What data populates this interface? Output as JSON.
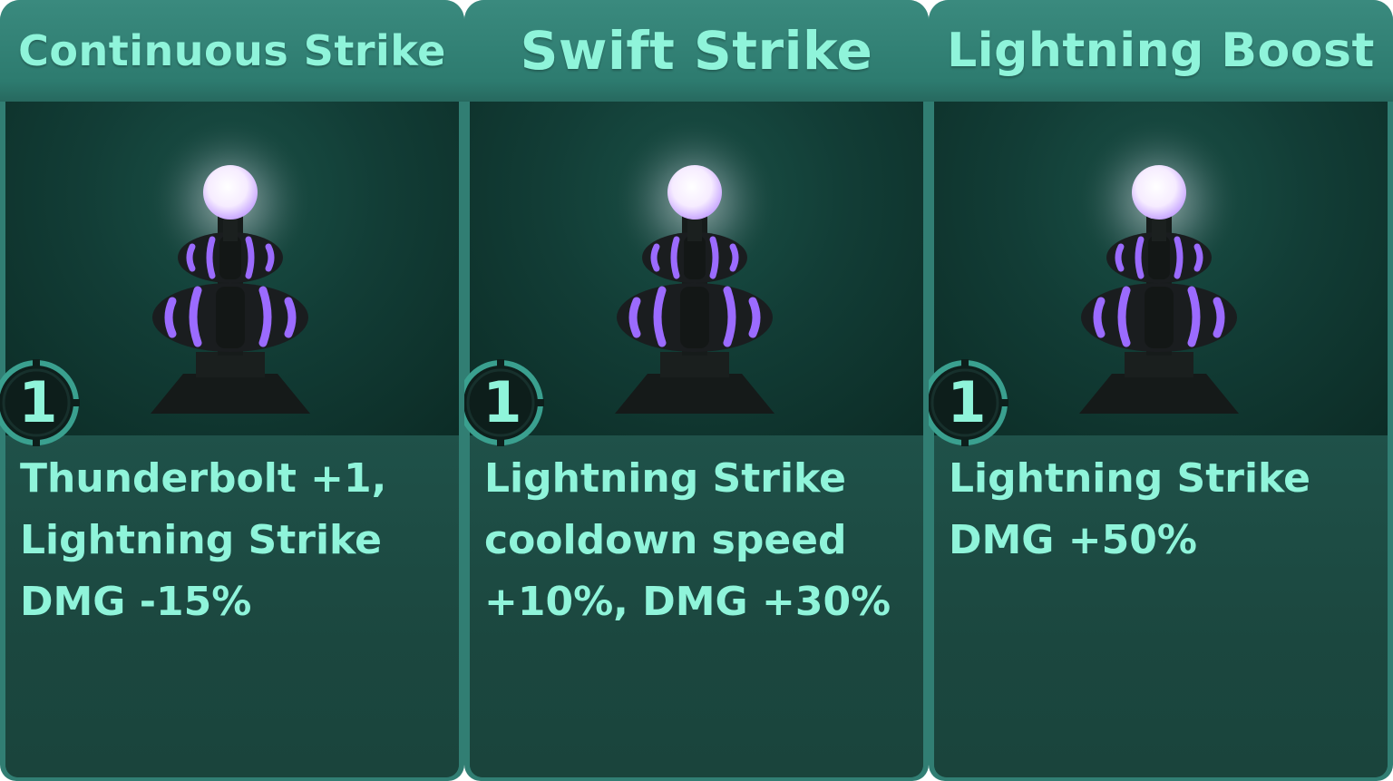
{
  "cards": [
    {
      "title": "Continuous Strike",
      "level": "1",
      "description": "Thunderbolt +1,\nLightning Strike\nDMG -15%",
      "icon": "lightning-tower-icon"
    },
    {
      "title": "Swift Strike",
      "level": "1",
      "description": "Lightning Strike\ncooldown speed\n+10%, DMG +30%",
      "icon": "lightning-tower-icon"
    },
    {
      "title": "Lightning Boost",
      "level": "1",
      "description": "Lightning Strike\nDMG +50%",
      "icon": "lightning-tower-icon"
    }
  ],
  "colors": {
    "card_frame": "#317e73",
    "card_body": "#1c4a42",
    "text": "#8ff4da",
    "tower_glow": "#f4e8ff",
    "tower_stripe": "#9b6bff"
  }
}
